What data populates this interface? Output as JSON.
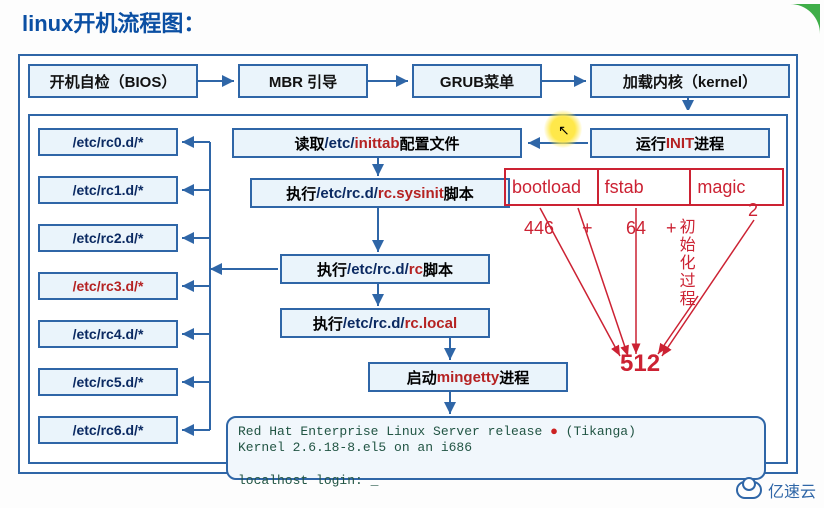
{
  "title": "linux开机流程图：",
  "top": {
    "bios": "开机自检（BIOS）",
    "mbr": "MBR 引导",
    "grub": "GRUB菜单",
    "kernel": "加载内核（kernel）"
  },
  "rc": [
    "/etc/rc0.d/*",
    "/etc/rc1.d/*",
    "/etc/rc2.d/*",
    "/etc/rc3.d/*",
    "/etc/rc4.d/*",
    "/etc/rc5.d/*",
    "/etc/rc6.d/*"
  ],
  "rc_highlight_index": 3,
  "steps": {
    "init": {
      "pre": "运行 ",
      "red": "INIT",
      "post": " 进程"
    },
    "inittab": {
      "pre": "读取",
      "blue": "/etc/",
      "red": "inittab",
      "post": "配置文件"
    },
    "sysinit": {
      "pre": "执行 ",
      "blue": "/etc/rc.d/",
      "red": "rc.sysinit",
      "post": " 脚本"
    },
    "rc": {
      "pre": "执行",
      "blue": "/etc/rc.d/",
      "red": "rc",
      "post": "脚本"
    },
    "local": {
      "pre": "执行",
      "blue": "/etc/rc.d/",
      "red": "rc.local",
      "post": ""
    },
    "mingetty": {
      "pre": "启动 ",
      "red": "mingetty",
      "post": " 进程"
    }
  },
  "terminal": {
    "line1a": "Red Hat Enterprise Linux Server release ",
    "line1b": " (Tikanga)",
    "line2": "Kernel 2.6.18-8.el5 on an i686",
    "line3": "localhost login: _"
  },
  "overlay": {
    "cells": [
      "bootload",
      "fstab",
      "magic"
    ],
    "n446": "446",
    "plus": "+",
    "n64": "64",
    "init_text": "初始化过程",
    "n2": "2",
    "n512": "512"
  },
  "watermark": "亿速云"
}
